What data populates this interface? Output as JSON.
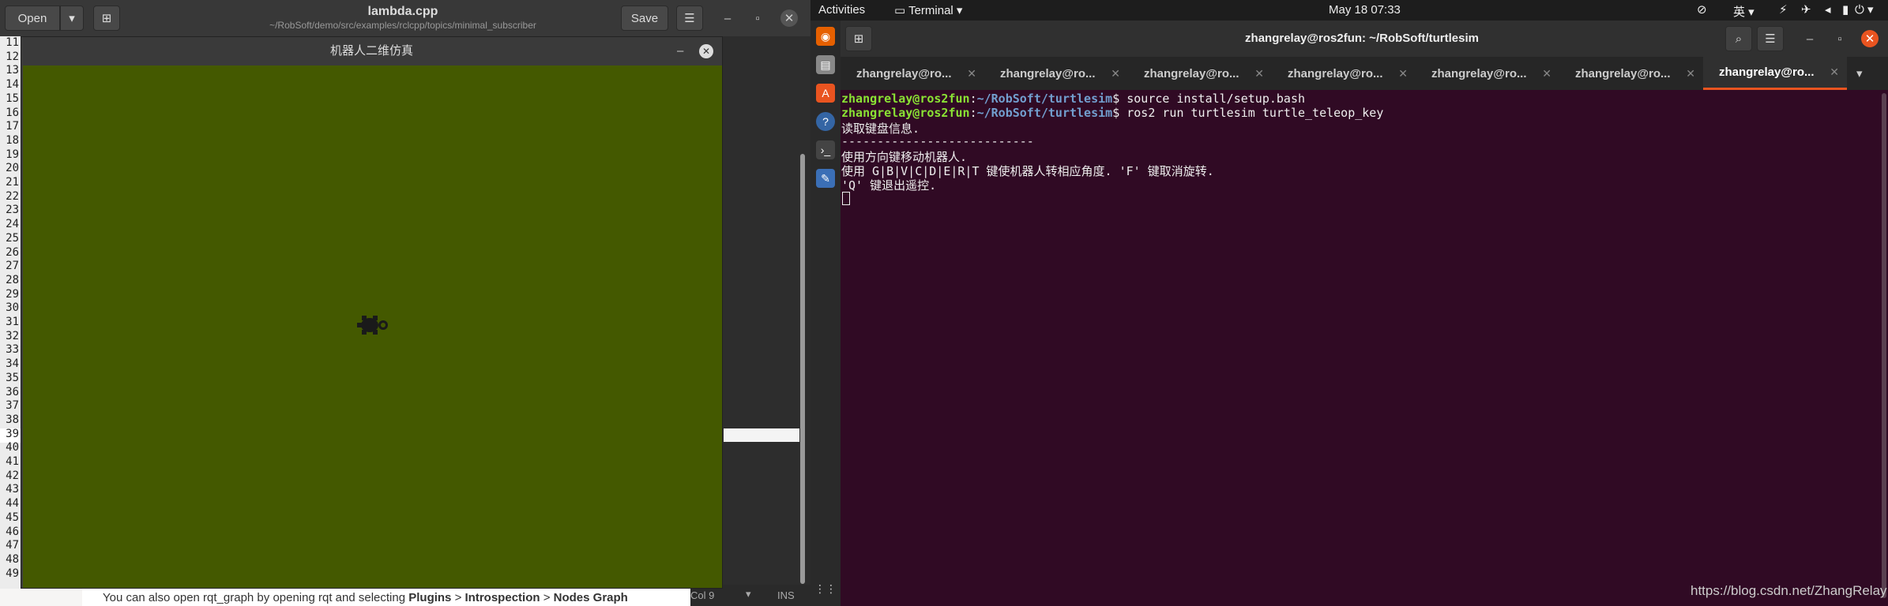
{
  "gedit": {
    "open_label": "Open",
    "save_label": "Save",
    "title": "lambda.cpp",
    "subtitle": "~/RobSoft/demo/src/examples/rclcpp/topics/minimal_subscriber",
    "line_numbers": [
      "11",
      "12",
      "13",
      "14",
      "15",
      "16",
      "17",
      "18",
      "19",
      "20",
      "21",
      "22",
      "23",
      "24",
      "25",
      "26",
      "27",
      "28",
      "29",
      "30",
      "31",
      "32",
      "33",
      "34",
      "35",
      "36",
      "37",
      "38",
      "39",
      "40",
      "41",
      "42",
      "43",
      "44",
      "45",
      "46",
      "47",
      "48",
      "49"
    ],
    "doc_text_pre": "You can also open rqt_graph by opening rqt and selecting ",
    "doc_bold1": "Plugins",
    "doc_sep1": " > ",
    "doc_bold2": "Introspection",
    "doc_sep2": " > ",
    "doc_bold3": "Nodes Graph",
    "status_col": "Col 9",
    "status_ins": "INS"
  },
  "turtlesim": {
    "title": "机器人二维仿真",
    "background": "#445900"
  },
  "topbar": {
    "activities": "Activities",
    "app": "Terminal",
    "clock": "May 18  07:33",
    "ime": "英"
  },
  "terminal": {
    "title": "zhangrelay@ros2fun: ~/RobSoft/turtlesim",
    "tabs": [
      "zhangrelay@ro...",
      "zhangrelay@ro...",
      "zhangrelay@ro...",
      "zhangrelay@ro...",
      "zhangrelay@ro...",
      "zhangrelay@ro...",
      "zhangrelay@ro..."
    ],
    "prompt_user": "zhangrelay@ros2fun",
    "prompt_path": "~/RobSoft/turtlesim",
    "cmd1": "$ source install/setup.bash",
    "cmd2": "$ ros2 run turtlesim turtle_teleop_key",
    "out1": "读取键盘信息.",
    "out2": "---------------------------",
    "out3": "使用方向键移动机器人.",
    "out4": "使用 G|B|V|C|D|E|R|T 键使机器人转相应角度. 'F' 键取消旋转.",
    "out5": "'Q' 键退出遥控."
  },
  "watermark": "https://blog.csdn.net/ZhangRelay",
  "colors": {
    "terminal_bg": "#300a24",
    "prompt_user": "#8ae234",
    "prompt_path": "#729fcf",
    "active_tab_underline": "#e95420"
  }
}
